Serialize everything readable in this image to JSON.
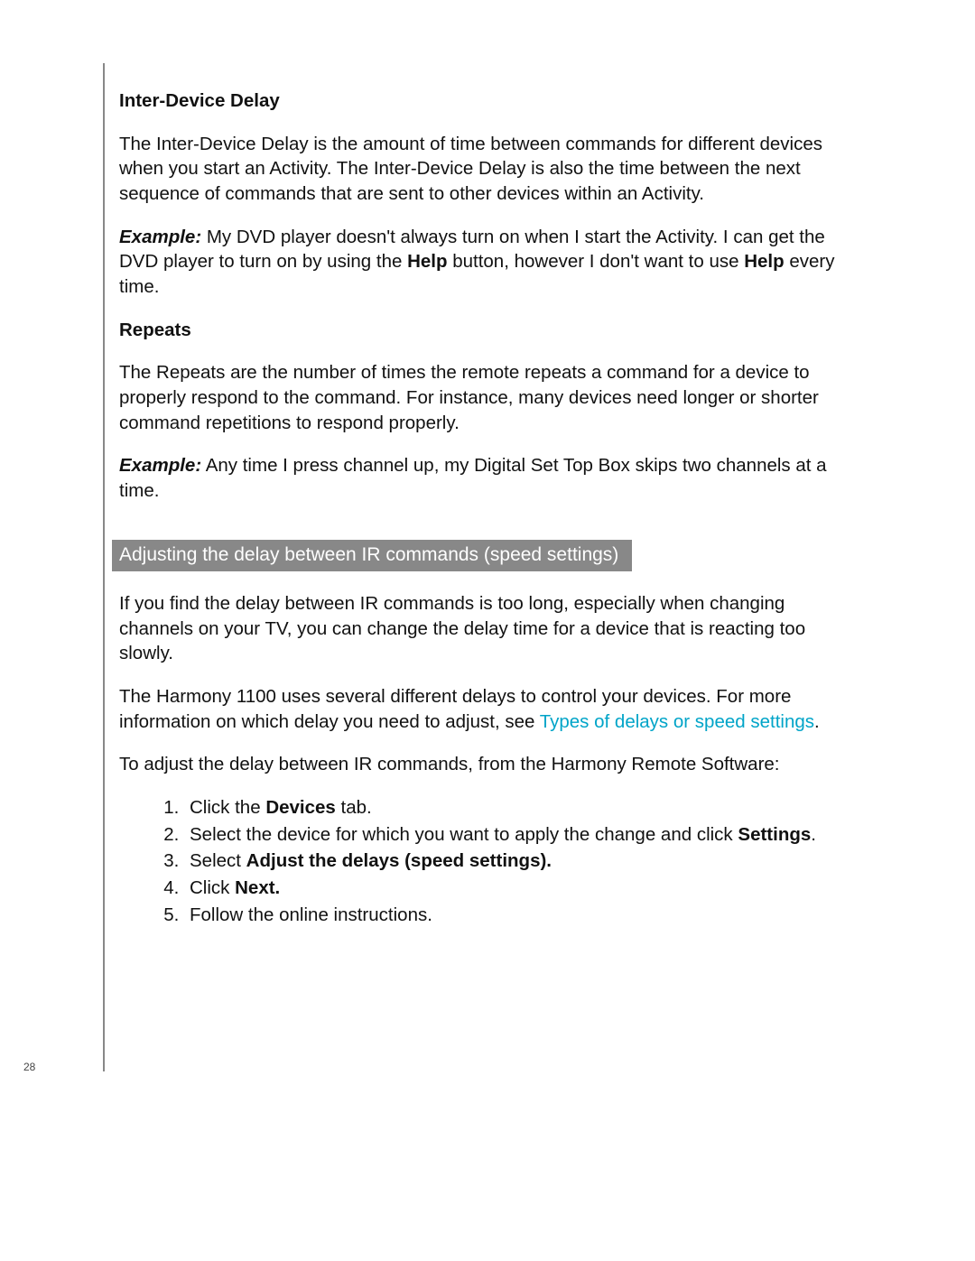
{
  "page_number": "28",
  "sections": {
    "inter_device_delay": {
      "heading": "Inter-Device Delay",
      "body": "The Inter-Device Delay is the amount of time between commands for different devices when you start an Activity. The Inter-Device Delay is also the time between the next sequence of commands that are sent to other devices within an Activity.",
      "example_label": "Example:",
      "example_pre": " My DVD player doesn't always turn on when I start the Activity. I can get the DVD player to turn on by using the ",
      "example_b1": "Help",
      "example_mid": " button, however I don't want to use ",
      "example_b2": "Help",
      "example_post": " every time."
    },
    "repeats": {
      "heading": "Repeats",
      "body": "The Repeats are the number of times the remote repeats a command for a device to properly respond to the command. For instance, many devices need longer or shorter command repetitions to respond properly.",
      "example_label": "Example:",
      "example_body": " Any time I press channel up, my Digital Set Top Box skips two channels at a time."
    },
    "adjusting": {
      "bar": "Adjusting the delay between IR commands (speed settings)",
      "p1": "If you find the delay between IR commands is too long, especially when changing channels on your TV, you can change the delay time for a device that is reacting too slowly.",
      "p2_pre": "The Harmony 1100 uses several different delays to control your devices. For more information on which delay you need to adjust, see ",
      "p2_link": "Types of delays or speed settings",
      "p2_post": ".",
      "p3": "To adjust the delay between IR commands, from the Harmony Remote Software:",
      "steps": {
        "s1_pre": "Click the ",
        "s1_b": "Devices",
        "s1_post": " tab.",
        "s2_pre": "Select the device for which you want to apply the change and click ",
        "s2_b": "Settings",
        "s2_post": ".",
        "s3_pre": "Select ",
        "s3_b": "Adjust the delays (speed settings).",
        "s4_pre": "Click ",
        "s4_b": "Next.",
        "s5": "Follow the online instructions."
      }
    }
  }
}
